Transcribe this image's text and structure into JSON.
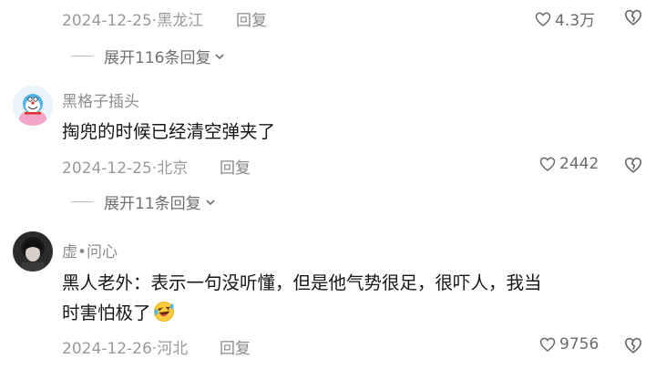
{
  "comment_top": {
    "date": "2024-12-25",
    "location": "黑龙江",
    "reply_label": "回复",
    "likes": "4.3万",
    "expand_label": "展开116条回复"
  },
  "comment_1": {
    "username": "黑格子插头",
    "text": "掏兜的时候已经清空弹夹了",
    "date": "2024-12-25",
    "location": "北京",
    "reply_label": "回复",
    "likes": "2442",
    "expand_label": "展开11条回复"
  },
  "comment_2": {
    "username": "虚•问心",
    "text_line1": "黑人老外：表示一句没听懂，但是他气势很足，很吓人，我当",
    "text_line2": "时害怕极了",
    "date": "2024-12-26",
    "location": "河北",
    "reply_label": "回复",
    "likes": "9756"
  },
  "separator": "·",
  "icons": {
    "like": "heart-outline-icon",
    "dislike": "broken-heart-outline-icon",
    "expand": "chevron-down-icon",
    "emoji": "laughing-tears-emoji"
  },
  "colors": {
    "meta_text": "#9a9a9a",
    "username": "#8c8c8c",
    "comment_text": "#161616"
  }
}
